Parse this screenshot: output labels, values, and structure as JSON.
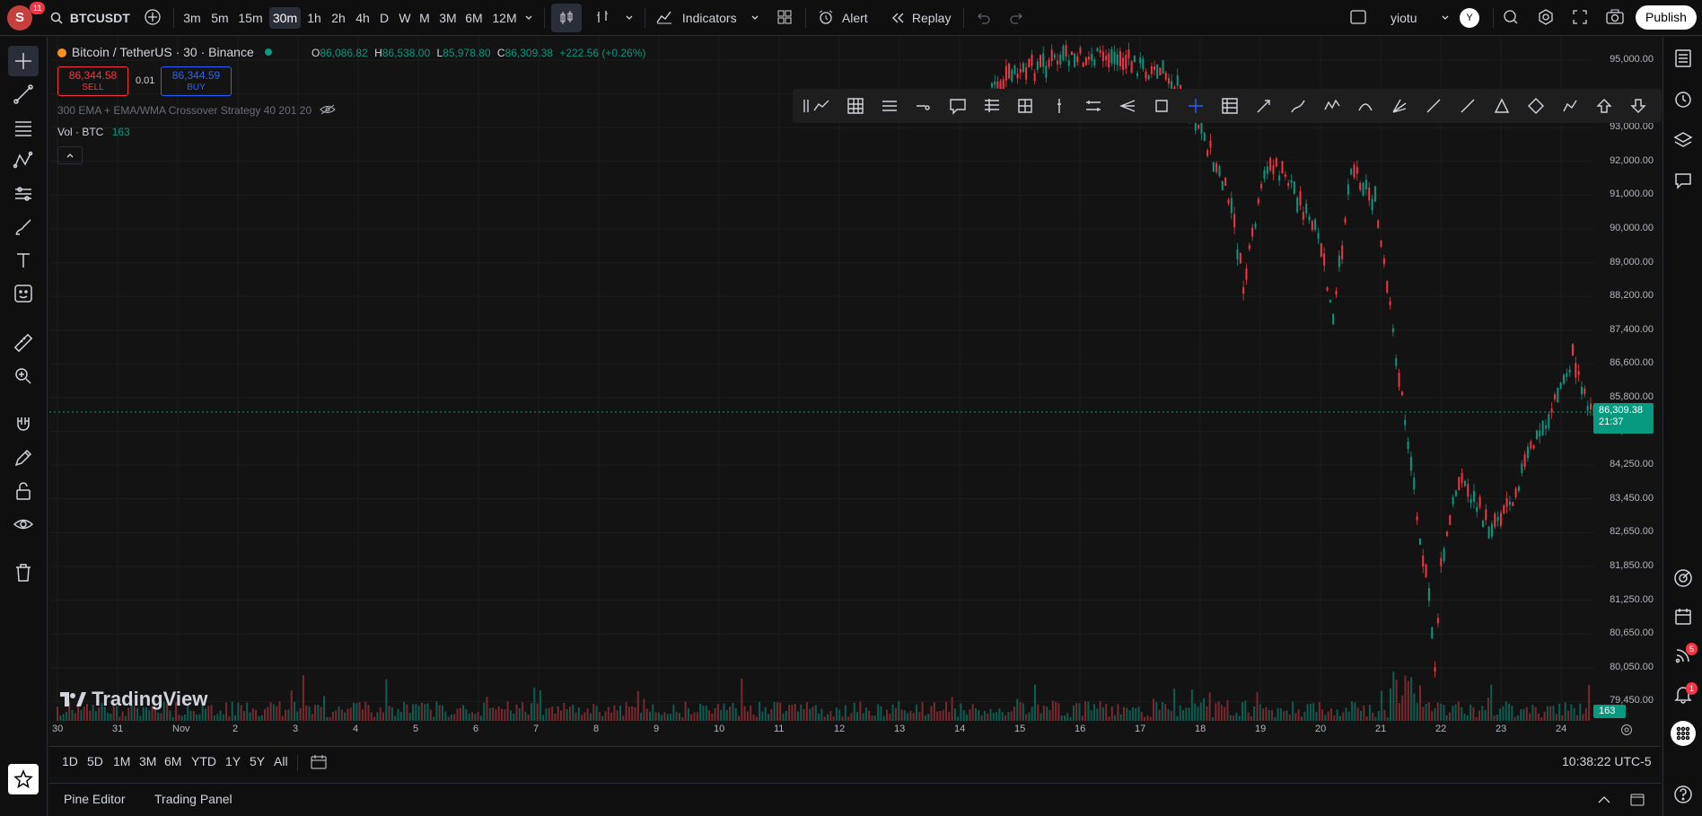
{
  "topbar": {
    "avatar_letter": "S",
    "notif_count": "11",
    "symbol": "BTCUSDT",
    "timeframes": [
      "3m",
      "5m",
      "15m",
      "30m",
      "1h",
      "2h",
      "4h",
      "D",
      "W",
      "M",
      "3M",
      "6M",
      "12M"
    ],
    "active_timeframe": "30m",
    "indicators_label": "Indicators",
    "alert_label": "Alert",
    "replay_label": "Replay",
    "username": "yiotu",
    "user_initial": "Y",
    "publish_label": "Publish"
  },
  "legend": {
    "title": "Bitcoin / TetherUS · 30 · Binance",
    "o_label": "O",
    "o_value": "86,086.82",
    "h_label": "H",
    "h_value": "86,538.00",
    "l_label": "L",
    "l_value": "85,978.80",
    "c_label": "C",
    "c_value": "86,309.38",
    "change": "+222.56 (+0.26%)",
    "sell_price": "86,344.58",
    "sell_label": "SELL",
    "spread": "0.01",
    "buy_price": "86,344.59",
    "buy_label": "BUY",
    "strategy": "300 EMA + EMA/WMA Crossover Strategy 40 201 20",
    "vol_label": "Vol · BTC",
    "vol_value": "163"
  },
  "price_axis": [
    "95,000.00",
    "94,000.00",
    "93,000.00",
    "92,000.00",
    "91,000.00",
    "90,000.00",
    "89,000.00",
    "88,200.00",
    "87,400.00",
    "86,600.00",
    "85,800.00",
    "85,000.00",
    "84,250.00",
    "83,450.00",
    "82,650.00",
    "81,850.00",
    "81,250.00",
    "80,650.00",
    "80,050.00",
    "79,450.00"
  ],
  "current_price": "86,309.38",
  "countdown": "21:37",
  "vol_tag": "163",
  "time_axis": [
    "30",
    "31",
    "Nov",
    "2",
    "3",
    "4",
    "5",
    "6",
    "7",
    "8",
    "9",
    "10",
    "11",
    "12",
    "13",
    "14",
    "15",
    "16",
    "17",
    "18",
    "19",
    "20",
    "21",
    "22",
    "23",
    "24"
  ],
  "watermark": "TradingView",
  "range_buttons": [
    "1D",
    "5D",
    "1M",
    "3M",
    "6M",
    "YTD",
    "1Y",
    "5Y",
    "All"
  ],
  "clock": "10:38:22 UTC-5",
  "bottom_tabs": {
    "pine": "Pine Editor",
    "trading": "Trading Panel"
  },
  "right_badges": {
    "signals": "5",
    "alerts": "1"
  },
  "colors": {
    "up": "#089981",
    "down": "#f23645",
    "bg": "#131313",
    "panel": "#0f0f0f"
  },
  "chart_data": {
    "type": "candlestick",
    "symbol": "BTCUSDT",
    "interval": "30",
    "ylim": [
      79450,
      95400
    ],
    "x_labels": [
      "30",
      "31",
      "Nov",
      "2",
      "3",
      "4",
      "5",
      "6",
      "7",
      "8",
      "9",
      "10",
      "11",
      "12",
      "13",
      "14",
      "15",
      "16",
      "17",
      "18",
      "19",
      "20",
      "21",
      "22",
      "23",
      "24"
    ],
    "visible_path": [
      {
        "date": "14",
        "price": 94600
      },
      {
        "date": "15",
        "price": 95200
      },
      {
        "date": "16",
        "price": 95300
      },
      {
        "date": "17",
        "price": 94800
      },
      {
        "date": "17.5",
        "price": 93500
      },
      {
        "date": "18",
        "price": 91600
      },
      {
        "date": "18.2",
        "price": 89600
      },
      {
        "date": "18.6",
        "price": 92700
      },
      {
        "date": "19",
        "price": 92200
      },
      {
        "date": "19.5",
        "price": 90600
      },
      {
        "date": "19.7",
        "price": 88700
      },
      {
        "date": "20",
        "price": 92700
      },
      {
        "date": "20.4",
        "price": 91700
      },
      {
        "date": "20.8",
        "price": 87400
      },
      {
        "date": "21",
        "price": 85300
      },
      {
        "date": "21.3",
        "price": 81850
      },
      {
        "date": "21.4",
        "price": 80300
      },
      {
        "date": "21.5",
        "price": 82650
      },
      {
        "date": "21.8",
        "price": 85000
      },
      {
        "date": "22.3",
        "price": 83700
      },
      {
        "date": "22.7",
        "price": 84500
      },
      {
        "date": "23",
        "price": 85600
      },
      {
        "date": "23.3",
        "price": 86400
      },
      {
        "date": "23.7",
        "price": 87900
      },
      {
        "date": "24",
        "price": 86600
      },
      {
        "date": "24.3",
        "price": 86309
      }
    ],
    "last_price": 86309.38,
    "volume_last": 163
  }
}
